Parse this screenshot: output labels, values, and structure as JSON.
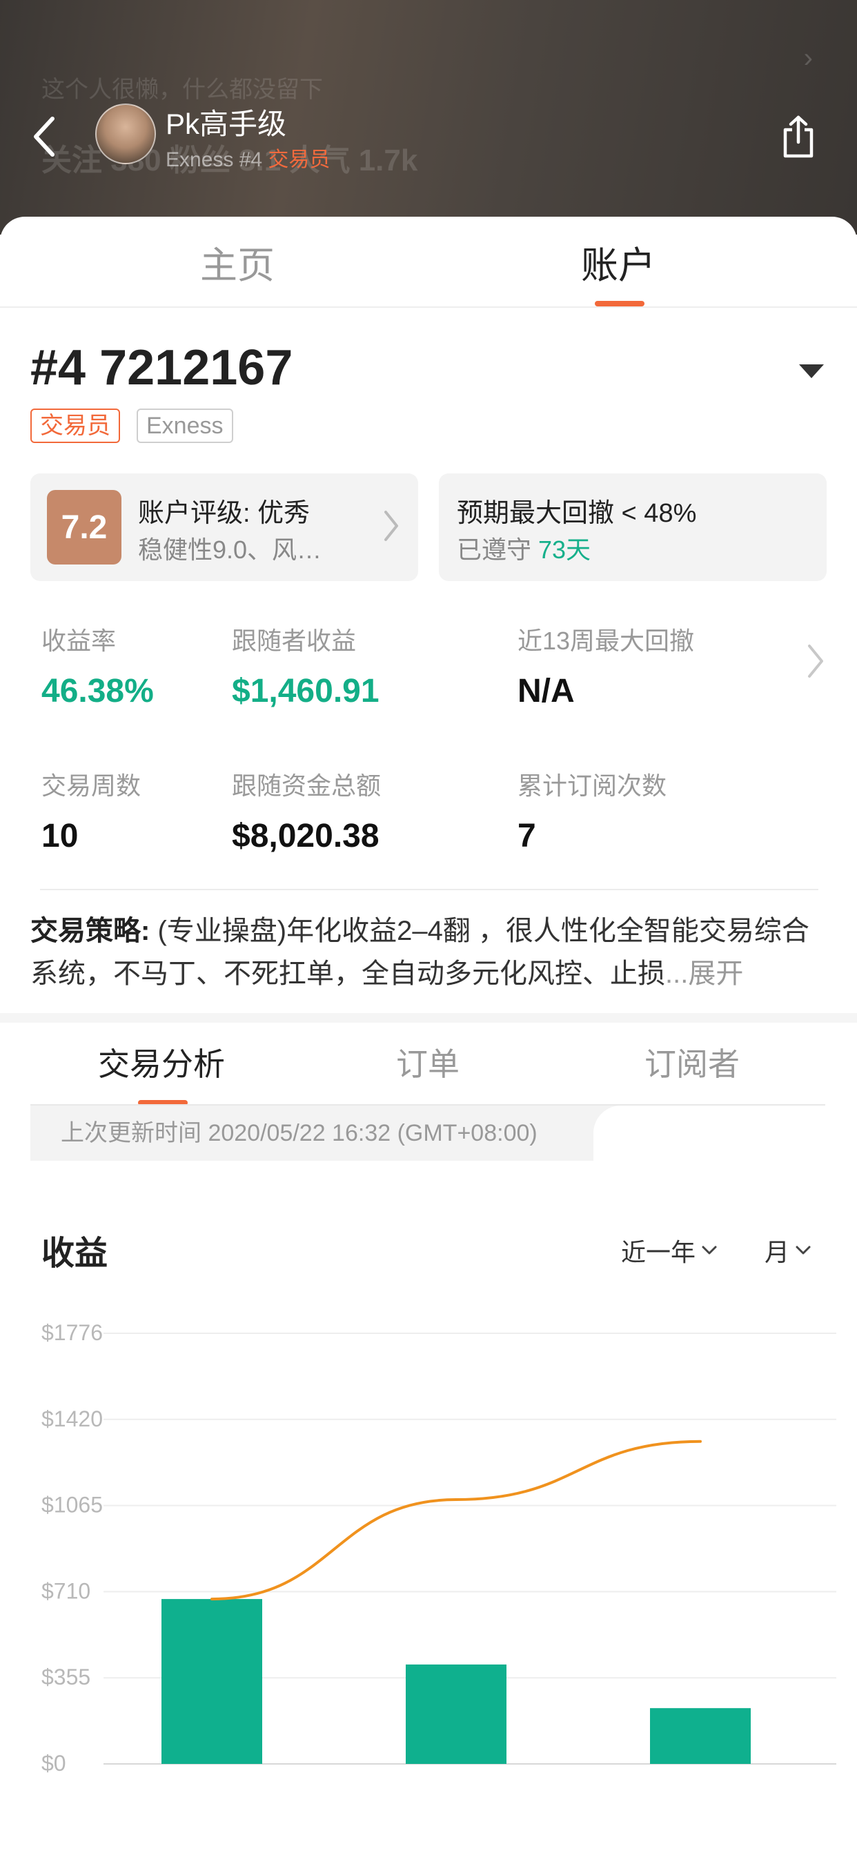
{
  "header": {
    "bg_bio": "这个人很懒，什么都没留下",
    "bg_stats": "关注 380  粉丝 3.1  人气 1.7k",
    "trader_name": "Pk高手级",
    "trader_sub_prefix": "Exness #4 ",
    "trader_sub_role": "交易员"
  },
  "main_tabs": [
    {
      "label": "主页",
      "active": false
    },
    {
      "label": "账户",
      "active": true
    }
  ],
  "account": {
    "number": "#4 7212167",
    "badge_role": "交易员",
    "badge_broker": "Exness"
  },
  "cards": {
    "rating": {
      "score": "7.2",
      "title": "账户评级: 优秀",
      "sub": "稳健性9.0、风…"
    },
    "drawdown": {
      "title": "预期最大回撤 < 48%",
      "sub_prefix": "已遵守 ",
      "sub_days": "73天"
    }
  },
  "stats": [
    {
      "label": "收益率",
      "value": "46.38%",
      "green": true
    },
    {
      "label": "跟随者收益",
      "value": "$1,460.91",
      "green": true
    },
    {
      "label": "近13周最大回撤",
      "value": "N/A",
      "green": false
    },
    {
      "label": "交易周数",
      "value": "10",
      "green": false
    },
    {
      "label": "跟随资金总额",
      "value": "$8,020.38",
      "green": false
    },
    {
      "label": "累计订阅次数",
      "value": "7",
      "green": false
    }
  ],
  "strategy": {
    "label": "交易策略:",
    "text": " (专业操盘)年化收益2–4翻 ，很人性化全智能交易综合系统，不马丁、不死扛单，全自动多元化风控、止损",
    "expand": "...展开"
  },
  "sub_tabs": [
    {
      "label": "交易分析",
      "active": true
    },
    {
      "label": "订单",
      "active": false
    },
    {
      "label": "订阅者",
      "active": false
    }
  ],
  "update_text": "上次更新时间 2020/05/22 16:32 (GMT+08:00)",
  "chart_section": {
    "title": "收益",
    "filter_period": "近一年",
    "filter_unit": "月"
  },
  "colors": {
    "accent": "#f2693a",
    "green": "#13ae87",
    "bar": "#0fb08e",
    "line": "#f0921e",
    "score_bg": "#c6896a"
  },
  "chart_data": {
    "type": "bar",
    "y_ticks": [
      "$1776",
      "$1420",
      "$1065",
      "$710",
      "$355",
      "$0"
    ],
    "ylim": [
      0,
      1776
    ],
    "categories": [
      "",
      "",
      ""
    ],
    "series": [
      {
        "type": "bar",
        "values": [
          680,
          410,
          230
        ]
      },
      {
        "type": "line",
        "values": [
          680,
          1090,
          1330
        ]
      }
    ],
    "grid": true
  }
}
